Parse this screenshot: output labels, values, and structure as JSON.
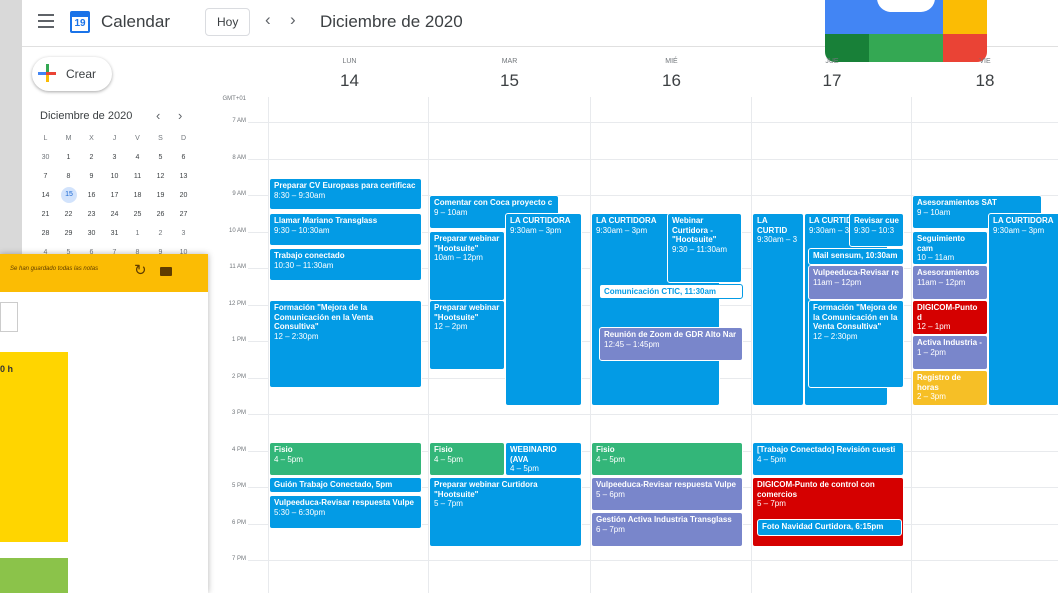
{
  "app": {
    "name": "Calendar",
    "logo_day": "19",
    "today_label": "Hoy",
    "prev": "‹",
    "next": "›",
    "period": "Diciembre de 2020",
    "menu_icon": "hamburger-menu-icon"
  },
  "sidebar": {
    "create_label": "Crear",
    "mini_month": {
      "title": "Diciembre de 2020",
      "prev": "‹",
      "next": "›",
      "weekdays": [
        "L",
        "M",
        "X",
        "J",
        "V",
        "S",
        "D"
      ],
      "weeks": [
        [
          "30",
          "1",
          "2",
          "3",
          "4",
          "5",
          "6"
        ],
        [
          "7",
          "8",
          "9",
          "10",
          "11",
          "12",
          "13"
        ],
        [
          "14",
          "15",
          "16",
          "17",
          "18",
          "19",
          "20"
        ],
        [
          "21",
          "22",
          "23",
          "24",
          "25",
          "26",
          "27"
        ],
        [
          "28",
          "29",
          "30",
          "31",
          "1",
          "2",
          "3"
        ],
        [
          "4",
          "5",
          "6",
          "7",
          "8",
          "9",
          "10"
        ]
      ],
      "today": "15"
    }
  },
  "timezone": "GMT+01",
  "hours": [
    "7 AM",
    "8 AM",
    "9 AM",
    "10 AM",
    "11 AM",
    "12 PM",
    "1 PM",
    "2 PM",
    "3 PM",
    "4 PM",
    "5 PM",
    "6 PM",
    "7 PM",
    "8 PM"
  ],
  "days": [
    {
      "name": "LUN",
      "num": "14"
    },
    {
      "name": "MAR",
      "num": "15"
    },
    {
      "name": "MIÉ",
      "num": "16"
    },
    {
      "name": "JUE",
      "num": "17"
    },
    {
      "name": "VIE",
      "num": "18"
    }
  ],
  "events": [
    {
      "title": "Preparar CV Europass para certificac",
      "time": "8:30 – 9:30am"
    },
    {
      "title": "Llamar Mariano Transglass",
      "time": "9:30 – 10:30am"
    },
    {
      "title": "Trabajo conectado",
      "time": "10:30 – 11:30am"
    },
    {
      "title": "Formación \"Mejora de la Comunicación en la Venta Consultiva\"",
      "time": "12 – 2:30pm"
    },
    {
      "title": "Fisio",
      "time": "4 – 5pm"
    },
    {
      "title": "Guión Trabajo Conectado, 5pm",
      "time": ""
    },
    {
      "title": "Vulpeeduca-Revisar respuesta Vulpe",
      "time": "5:30 – 6:30pm"
    },
    {
      "title": "Comentar con Coca proyecto c",
      "time": "9 – 10am"
    },
    {
      "title": "Preparar webinar \"Hootsuite\"",
      "time": "10am – 12pm"
    },
    {
      "title": "LA CURTIDORA",
      "time": "9:30am – 3pm"
    },
    {
      "title": "Preparar webinar \"Hootsuite\"",
      "time": "12 – 2pm"
    },
    {
      "title": "Fisio",
      "time": "4 – 5pm"
    },
    {
      "title": "WEBINARIO (AVA",
      "time": "4 – 5pm"
    },
    {
      "title": "Preparar webinar Curtidora \"Hootsuite\"",
      "time": "5 – 7pm"
    },
    {
      "title": "LA CURTIDORA",
      "time": "9:30am – 3pm"
    },
    {
      "title": "Webinar Curtidora - \"Hootsuite\"",
      "time": "9:30 – 11:30am"
    },
    {
      "title": "Comunicación CTIC, 11:30am",
      "time": ""
    },
    {
      "title": "Reunión de Zoom de GDR Alto Nar",
      "time": "12:45 – 1:45pm"
    },
    {
      "title": "Fisio",
      "time": "4 – 5pm"
    },
    {
      "title": "Vulpeeduca-Revisar respuesta Vulpe",
      "time": "5 – 6pm"
    },
    {
      "title": "Gestión Activa Industria Transglass",
      "time": "6 – 7pm"
    },
    {
      "title": "LA CURTID",
      "time": "9:30am – 3"
    },
    {
      "title": "LA CURTID",
      "time": "9:30am – 3"
    },
    {
      "title": "Revisar cue",
      "time": "9:30 – 10:3"
    },
    {
      "title": "Mail sensum, 10:30am",
      "time": ""
    },
    {
      "title": "Vulpeeduca-Revisar re",
      "time": "11am – 12pm"
    },
    {
      "title": "Formación \"Mejora de la Comunicación en la Venta Consultiva\"",
      "time": "12 – 2:30pm"
    },
    {
      "title": "[Trabajo Conectado] Revisión cuesti",
      "time": "4 – 5pm"
    },
    {
      "title": "DIGICOM-Punto de control con comercios",
      "time": "5 – 7pm"
    },
    {
      "title": "Foto Navidad Curtidora, 6:15pm",
      "time": ""
    },
    {
      "title": "Asesoramientos SAT",
      "time": "9 – 10am"
    },
    {
      "title": "Seguimiento cam",
      "time": "10 – 11am"
    },
    {
      "title": "LA CURTIDORA",
      "time": "9:30am – 3pm"
    },
    {
      "title": "Asesoramientos",
      "time": "11am – 12pm"
    },
    {
      "title": "DIGICOM-Punto d",
      "time": "12 – 1pm"
    },
    {
      "title": "Activa Industria -",
      "time": "1 – 2pm"
    },
    {
      "title": "Registro de horas",
      "time": "2 – 3pm"
    }
  ],
  "keep": {
    "saved": "Se han guardado todas las notas",
    "refresh_icon": "refresh-icon",
    "note_text": "0 h"
  },
  "colors": {
    "blue": "#039be5",
    "lavender": "#7986cb",
    "green": "#33b679",
    "red": "#d50000",
    "yellow": "#f6bf26",
    "keep": "#fbbc04"
  }
}
